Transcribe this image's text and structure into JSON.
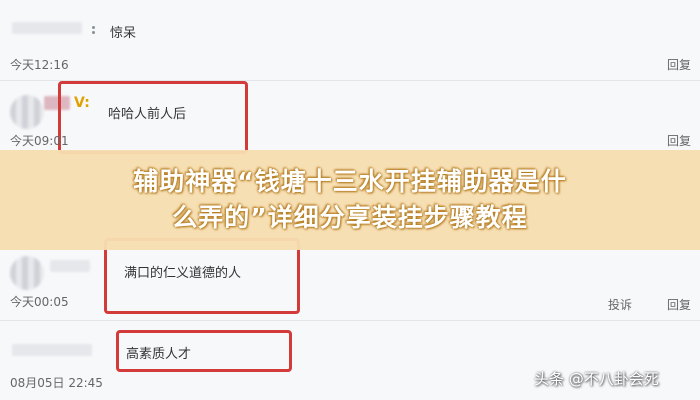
{
  "comments": [
    {
      "text": "惊呆",
      "time": "今天12:16",
      "reply": "回复"
    },
    {
      "badge": "V:",
      "text": "哈哈人前人后",
      "time": "今天09:01",
      "reply": "回复"
    },
    {
      "text": "满口的仁义道德的人",
      "time": "今天00:05",
      "report": "投诉",
      "reply": "回复"
    },
    {
      "text": "高素质人才",
      "time": "08月05日 22:45"
    }
  ],
  "banner": {
    "line1": "辅助神器“钱塘十三水开挂辅助器是什",
    "line2": "么弄的”详细分享装挂步骤教程"
  },
  "watermark": "头条 @不八卦会死",
  "colors": {
    "highlight_box": "#d33b3b",
    "banner_bg": "#f6deb0",
    "banner_text": "#ffffff"
  }
}
